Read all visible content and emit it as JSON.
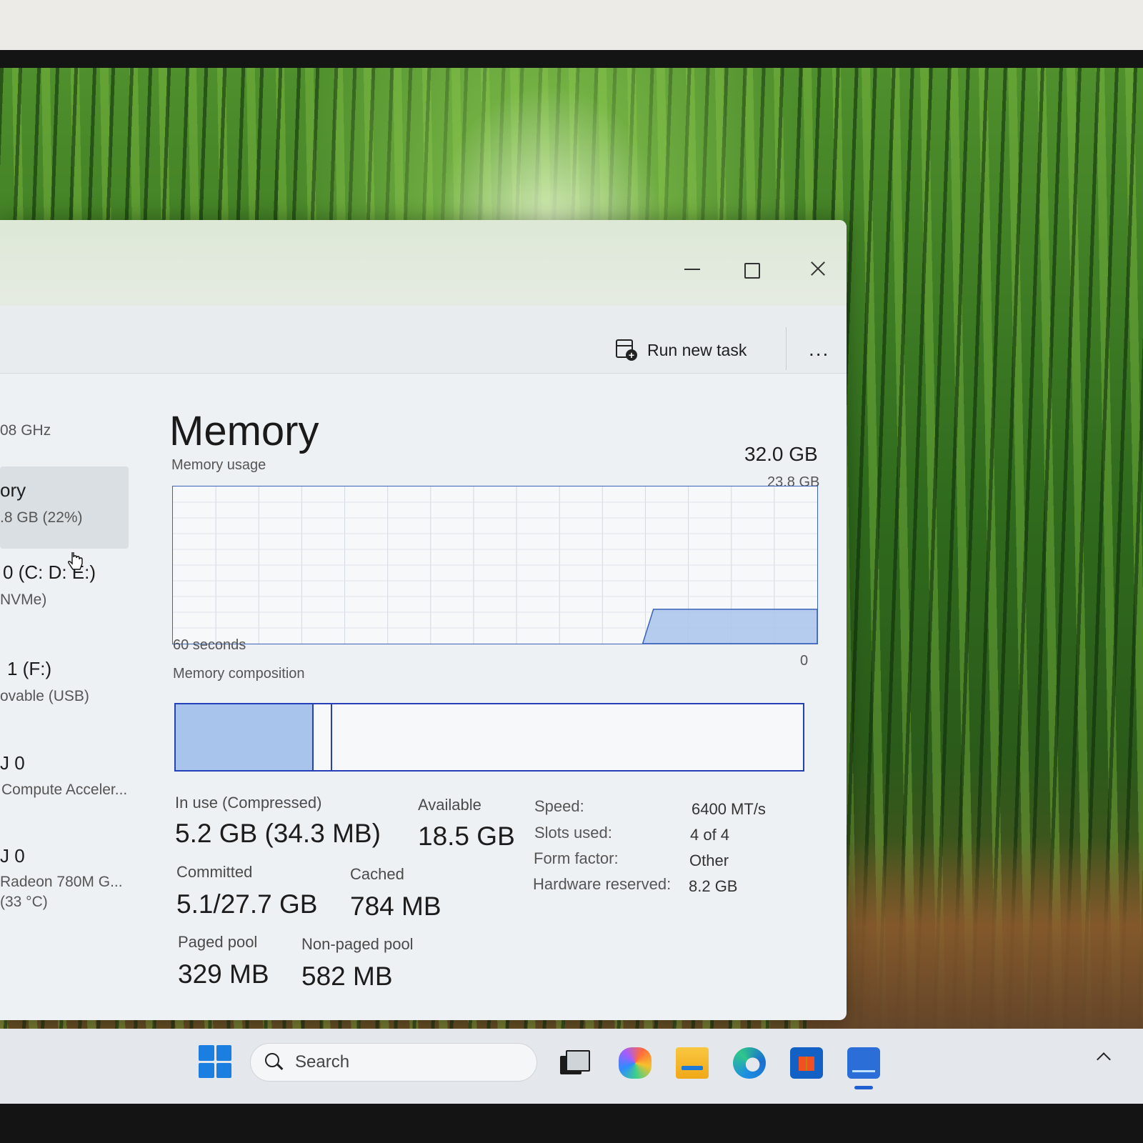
{
  "window": {
    "toolbar": {
      "run_new_task_label": "Run new task",
      "more_label": "..."
    }
  },
  "sidebar": {
    "items": [
      {
        "label": "",
        "sub": "08 GHz"
      },
      {
        "label": "ory",
        "sub": ".8 GB (22%)",
        "selected": true
      },
      {
        "label": "0 (C: D: E:)",
        "sub": "NVMe)"
      },
      {
        "label": "1 (F:)",
        "sub": "ovable (USB)"
      },
      {
        "label": "J 0",
        "sub": "Compute Acceler..."
      },
      {
        "label": "J 0",
        "sub": "Radeon 780M G...",
        "sub2": "(33 °C)"
      }
    ]
  },
  "memory": {
    "title": "Memory",
    "total": "32.0 GB",
    "usage_label": "Memory usage",
    "usage_max": "23.8 GB",
    "time_span": "60 seconds",
    "axis_min": "0",
    "composition_label": "Memory composition",
    "composition": {
      "in_use_fraction": 0.22,
      "modified_fraction": 0.03
    },
    "stats": {
      "in_use_label": "In use (Compressed)",
      "in_use_value": "5.2 GB (34.3 MB)",
      "available_label": "Available",
      "available_value": "18.5 GB",
      "committed_label": "Committed",
      "committed_value": "5.1/27.7 GB",
      "cached_label": "Cached",
      "cached_value": "784 MB",
      "paged_label": "Paged pool",
      "paged_value": "329 MB",
      "nonpaged_label": "Non-paged pool",
      "nonpaged_value": "582 MB"
    },
    "specs": [
      {
        "label": "Speed:",
        "value": "6400 MT/s"
      },
      {
        "label": "Slots used:",
        "value": "4 of 4"
      },
      {
        "label": "Form factor:",
        "value": "Other"
      },
      {
        "label": "Hardware reserved:",
        "value": "8.2 GB"
      }
    ],
    "usage_history_gb": [
      0,
      0,
      0,
      0,
      0,
      0,
      0,
      0,
      0,
      0,
      0,
      0,
      0,
      0,
      0,
      0,
      0,
      0,
      0,
      0,
      0,
      0,
      0,
      0,
      0,
      0,
      0,
      0,
      0,
      0,
      0,
      0,
      0,
      0,
      0,
      0,
      0,
      0,
      0,
      0,
      0,
      0,
      0,
      0,
      5.2,
      5.2,
      5.2,
      5.2,
      5.2,
      5.2,
      5.2,
      5.2,
      5.2,
      5.2,
      5.2,
      5.2,
      5.2,
      5.2,
      5.2,
      5.2
    ]
  },
  "taskbar": {
    "search_placeholder": "Search",
    "apps": [
      "task-view-icon",
      "copilot-icon",
      "file-explorer-icon",
      "edge-icon",
      "store-icon",
      "task-manager-icon"
    ]
  },
  "colors": {
    "graph_fill": "#a9c4ec",
    "graph_stroke": "#3b62b8",
    "composition_border": "#2540b8",
    "accent": "#1a7fe0"
  }
}
